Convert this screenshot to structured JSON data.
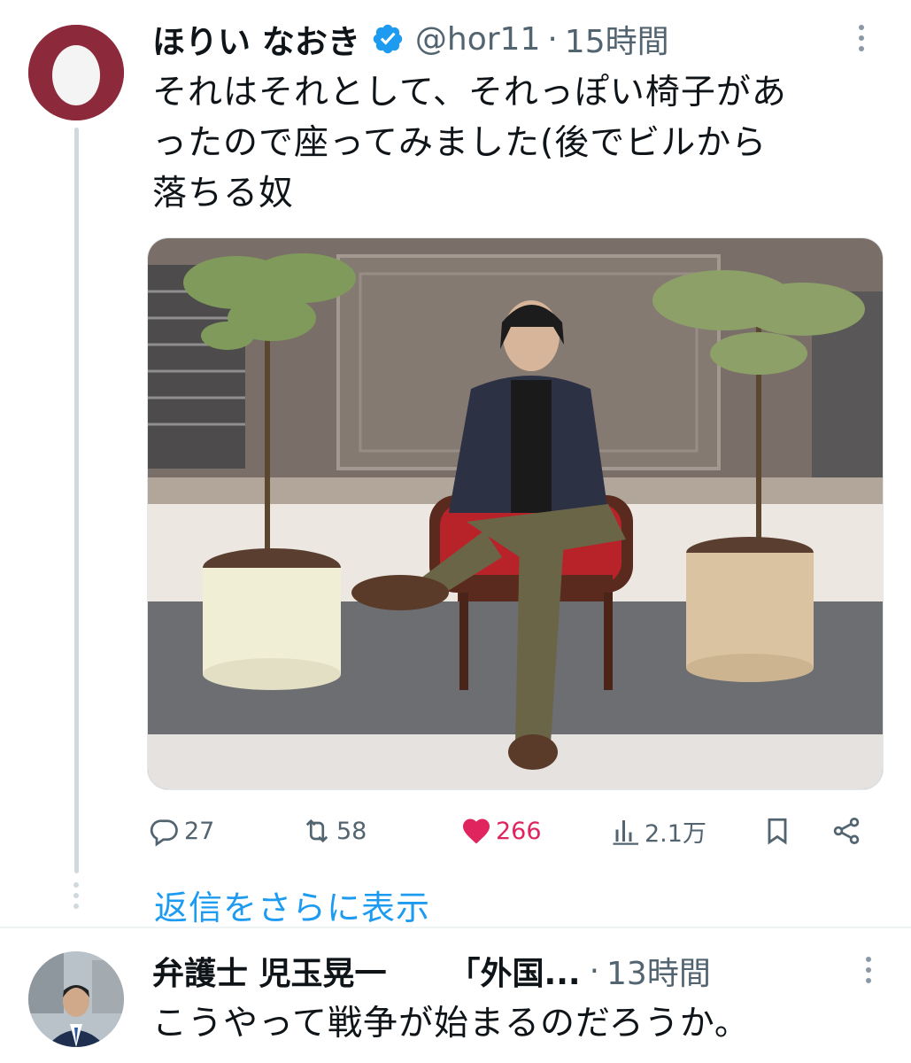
{
  "tweet1": {
    "author_name": "ほりい なおき",
    "handle": "@hor11",
    "separator": "·",
    "time": "15時間",
    "text": "それはそれとして、それっぽい椅子があ\nったので座ってみました(後でビルから\n落ちる奴",
    "stats": {
      "replies": "27",
      "retweets": "58",
      "likes": "266",
      "views": "2.1万"
    }
  },
  "show_more_replies": "返信をさらに表示",
  "tweet2": {
    "author_name": "弁護士 児玉晃一",
    "author_name_suffix": "「外国...",
    "separator": "·",
    "time": "13時間",
    "text": "こうやって戦争が始まるのだろうか。"
  },
  "colors": {
    "accent": "#1d9bf0",
    "like": "#e0245e",
    "secondary_text": "#536471",
    "avatar1_bg": "#8c2a3c"
  },
  "icons": [
    "verified-badge-icon",
    "more-icon",
    "reply-icon",
    "retweet-icon",
    "heart-icon",
    "views-icon",
    "bookmark-icon",
    "share-icon"
  ]
}
